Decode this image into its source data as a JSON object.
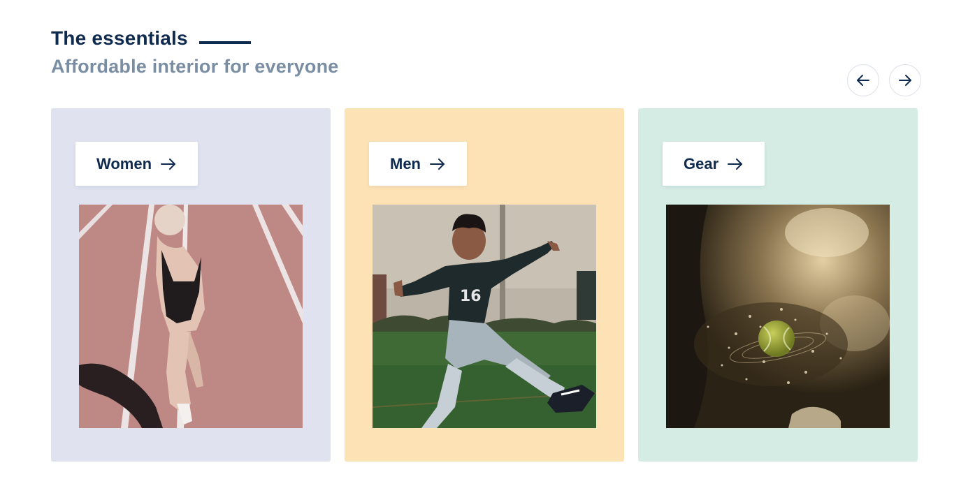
{
  "header": {
    "title": "The essentials",
    "subtitle": "Affordable interior for everyone"
  },
  "carousel": {
    "prev_icon": "arrow-left-icon",
    "next_icon": "arrow-right-icon"
  },
  "categories": [
    {
      "label": "Women",
      "icon": "arrow-right-icon",
      "bg_color": "#e0e2f0",
      "image": "woman running on red track"
    },
    {
      "label": "Men",
      "icon": "arrow-right-icon",
      "bg_color": "#fde2b5",
      "image": "soccer player kicking on field"
    },
    {
      "label": "Gear",
      "icon": "arrow-right-icon",
      "bg_color": "#d4ece4",
      "image": "tennis ball with sparks"
    }
  ],
  "colors": {
    "title": "#0f2a4f",
    "subtitle": "#7a8ea3"
  }
}
